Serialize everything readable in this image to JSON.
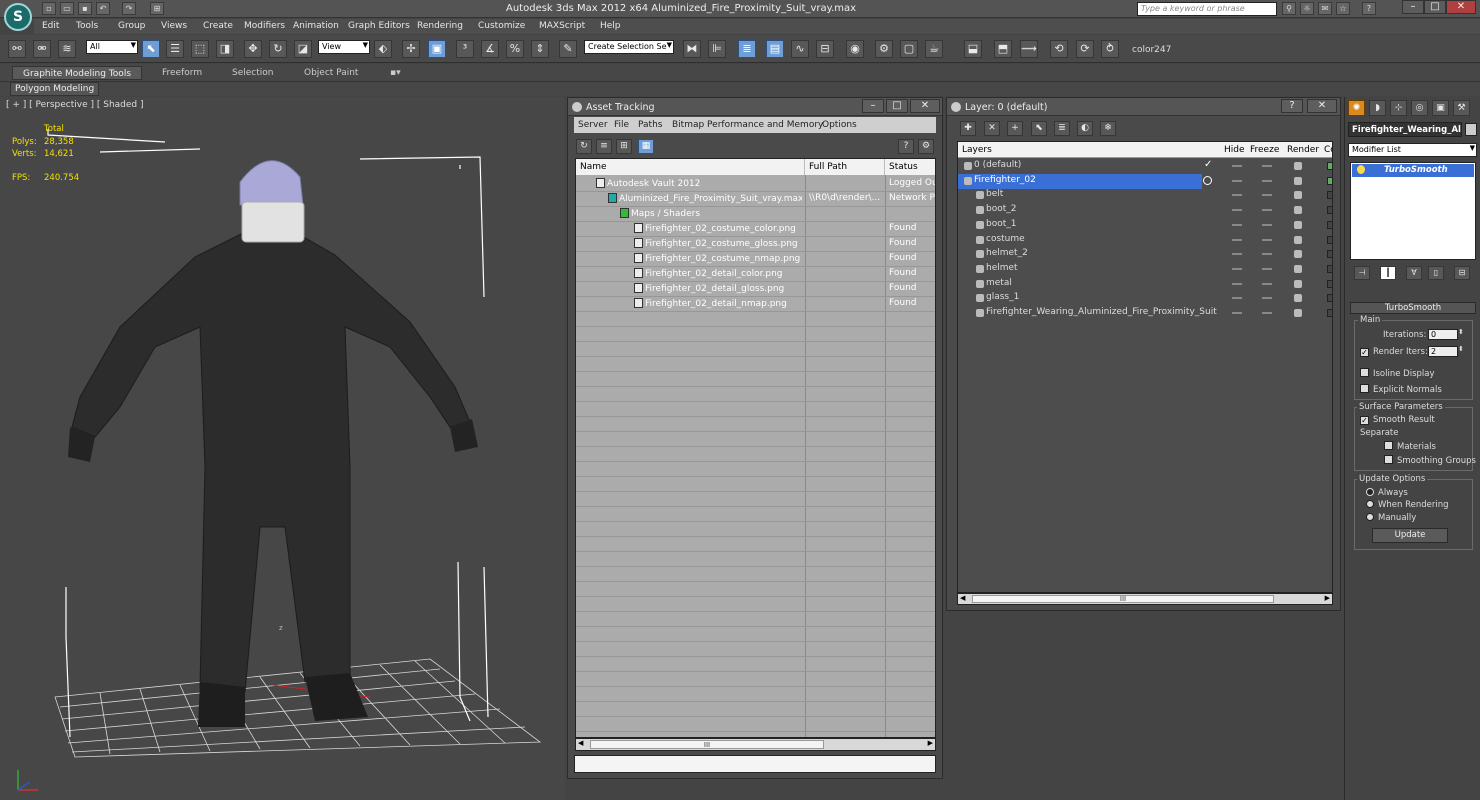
{
  "app": {
    "title": "Autodesk 3ds Max  2012 x64      Aluminized_Fire_Proximity_Suit_vray.max",
    "logo": "S",
    "search_placeholder": "Type a keyword or phrase"
  },
  "menus": [
    "Edit",
    "Tools",
    "Group",
    "Views",
    "Create",
    "Modifiers",
    "Animation",
    "Graph Editors",
    "Rendering",
    "Customize",
    "MAXScript",
    "Help"
  ],
  "toolbar": {
    "filter_value": "All",
    "refcoord_value": "View",
    "selection_set_placeholder": "Create Selection Se",
    "material_label": "color247"
  },
  "ribbon": {
    "tabs": [
      "Graphite Modeling Tools",
      "Freeform",
      "Selection",
      "Object Paint"
    ],
    "sub_label": "Polygon Modeling"
  },
  "viewport": {
    "label": "[ + ] [ Perspective ] [ Shaded ]",
    "stats": {
      "header": "Total",
      "polys_label": "Polys:",
      "polys_value": "28,358",
      "verts_label": "Verts:",
      "verts_value": "14,621",
      "fps_label": "FPS:",
      "fps_value": "240.754"
    },
    "axis_z": "z"
  },
  "asset_tracking": {
    "title": "Asset Tracking",
    "menu": [
      "Server",
      "File",
      "Paths",
      "Bitmap Performance and Memory",
      "Options"
    ],
    "columns": [
      "Name",
      "Full Path",
      "Status"
    ],
    "rows": [
      {
        "name": "Autodesk Vault 2012",
        "path": "",
        "status": "Logged Out"
      },
      {
        "name": "Aluminized_Fire_Proximity_Suit_vray.max",
        "path": "\\\\R0\\d\\render\\...",
        "status": "Network Pa"
      },
      {
        "name": "Maps / Shaders",
        "path": "",
        "status": ""
      },
      {
        "name": "Firefighter_02_costume_color.png",
        "path": "",
        "status": "Found"
      },
      {
        "name": "Firefighter_02_costume_gloss.png",
        "path": "",
        "status": "Found"
      },
      {
        "name": "Firefighter_02_costume_nmap.png",
        "path": "",
        "status": "Found"
      },
      {
        "name": "Firefighter_02_detail_color.png",
        "path": "",
        "status": "Found"
      },
      {
        "name": "Firefighter_02_detail_gloss.png",
        "path": "",
        "status": "Found"
      },
      {
        "name": "Firefighter_02_detail_nmap.png",
        "path": "",
        "status": "Found"
      }
    ],
    "scroll_grip": "III"
  },
  "layer_manager": {
    "title": "Layer: 0 (default)",
    "columns": [
      "Layers",
      "Hide",
      "Freeze",
      "Render",
      "Col"
    ],
    "rows": [
      {
        "name": "0 (default)",
        "level": 0
      },
      {
        "name": "Firefighter_02",
        "level": 0
      },
      {
        "name": "belt",
        "level": 1
      },
      {
        "name": "boot_2",
        "level": 1
      },
      {
        "name": "boot_1",
        "level": 1
      },
      {
        "name": "costume",
        "level": 1
      },
      {
        "name": "helmet_2",
        "level": 1
      },
      {
        "name": "helmet",
        "level": 1
      },
      {
        "name": "metal",
        "level": 1
      },
      {
        "name": "glass_1",
        "level": 1
      },
      {
        "name": "Firefighter_Wearing_Aluminized_Fire_Proximity_Suit",
        "level": 1
      }
    ],
    "scroll_grip": "III",
    "check_mark": "✓"
  },
  "command_panel": {
    "object_name": "Firefighter_Wearing_Alu",
    "modifier_list_label": "Modifier List",
    "stack_item": "TurboSmooth",
    "rollout_title": "TurboSmooth",
    "main_label": "Main",
    "iterations_label": "Iterations:",
    "iterations_value": "0",
    "render_iters_label": "Render Iters:",
    "render_iters_value": "2",
    "isoline_label": "Isoline Display",
    "explicit_normals_label": "Explicit Normals",
    "surface_params_label": "Surface Parameters",
    "smooth_result_label": "Smooth Result",
    "separate_label": "Separate",
    "materials_label": "Materials",
    "smoothing_groups_label": "Smoothing Groups",
    "update_options_label": "Update Options",
    "always_label": "Always",
    "when_rendering_label": "When Rendering",
    "manually_label": "Manually",
    "update_button": "Update",
    "check_mark": "✓"
  },
  "colors": {
    "viewport_bg": "#474747",
    "selection_blue": "#3a6fd6",
    "stats_yellow": "#f4e000",
    "suit_dark": "#2a2a2a"
  }
}
